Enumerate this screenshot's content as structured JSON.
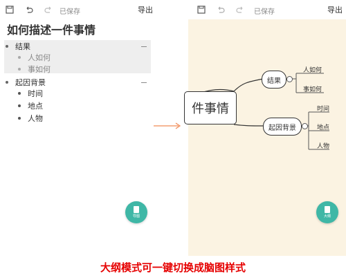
{
  "outline_view": {
    "toolbar": {
      "saved_label": "已保存",
      "export_label": "导出"
    },
    "title": "如何描述一件事情",
    "items": [
      {
        "label": "结果",
        "children": [
          "人如何",
          "事如何"
        ]
      },
      {
        "label": "起因背景",
        "children": [
          "时间",
          "地点",
          "人物"
        ]
      }
    ],
    "fab_label": "导图"
  },
  "mindmap_view": {
    "toolbar": {
      "saved_label": "已保存",
      "export_label": "导出"
    },
    "root_label": "件事情",
    "branches": [
      {
        "label": "结果",
        "leaves": [
          "人如何",
          "事如何"
        ]
      },
      {
        "label": "起因背景",
        "leaves": [
          "时间",
          "地点",
          "人物"
        ]
      }
    ],
    "fab_label": "大纲"
  },
  "caption": "大纲模式可一键切换成脑图样式",
  "colors": {
    "accent": "#3fb7a6",
    "map_bg": "#fbf3e2",
    "caption": "#e60000",
    "arrow": "#f08a55"
  }
}
